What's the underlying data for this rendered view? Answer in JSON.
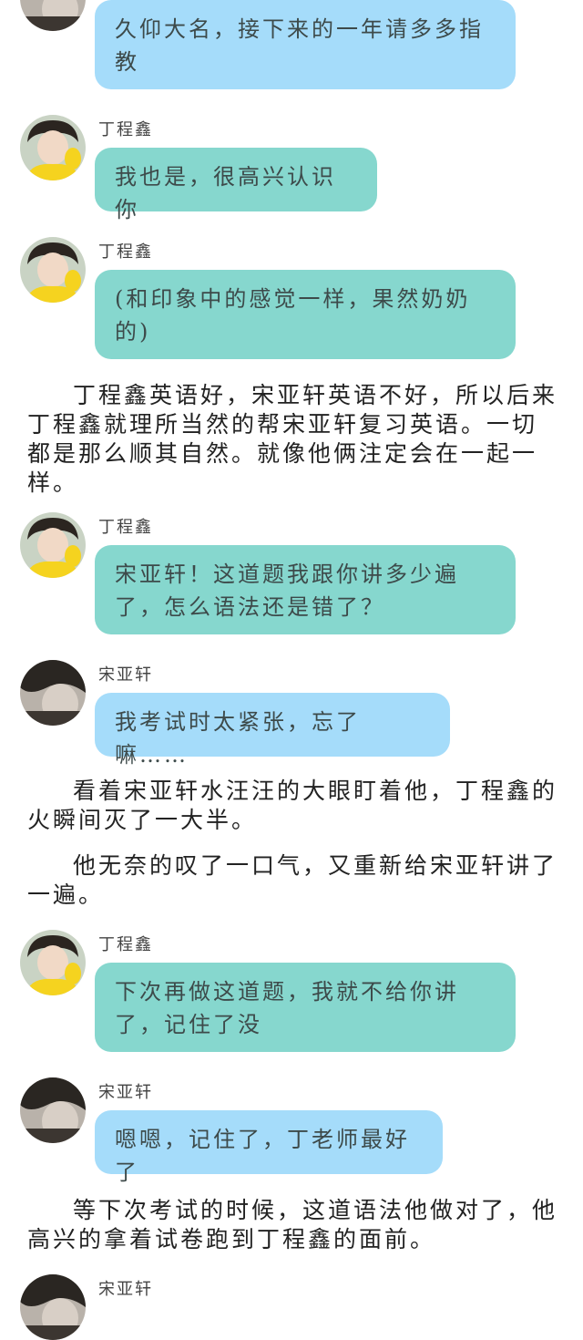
{
  "colors": {
    "blue_bubble": "#a5dcfa",
    "teal_bubble": "#86d7ce"
  },
  "messages": [
    {
      "speaker": "",
      "text": "久仰大名，接下来的一年请多多指教",
      "bubble": "blue"
    },
    {
      "speaker": "丁程鑫",
      "text": "我也是，很高兴认识你",
      "bubble": "teal"
    },
    {
      "speaker": "丁程鑫",
      "text": "(和印象中的感觉一样，果然奶奶的)",
      "bubble": "teal"
    },
    {
      "speaker": "丁程鑫",
      "text": "宋亚轩！这道题我跟你讲多少遍了，怎么语法还是错了？",
      "bubble": "teal"
    },
    {
      "speaker": "宋亚轩",
      "text": "我考试时太紧张，忘了嘛……",
      "bubble": "blue"
    },
    {
      "speaker": "丁程鑫",
      "text": "下次再做这道题，我就不给你讲了，记住了没",
      "bubble": "teal"
    },
    {
      "speaker": "宋亚轩",
      "text": "嗯嗯，记住了，丁老师最好了",
      "bubble": "blue"
    },
    {
      "speaker": "宋亚轩",
      "text": "",
      "bubble": ""
    }
  ],
  "paragraphs": [
    "丁程鑫英语好，宋亚轩英语不好，所以后来丁程鑫就理所当然的帮宋亚轩复习英语。一切都是那么顺其自然。就像他俩注定会在一起一样。",
    "看着宋亚轩水汪汪的大眼盯着他，丁程鑫的火瞬间灭了一大半。",
    "他无奈的叹了一口气，又重新给宋亚轩讲了一遍。",
    "等下次考试的时候，这道语法他做对了，他高兴的拿着试卷跑到丁程鑫的面前。"
  ]
}
